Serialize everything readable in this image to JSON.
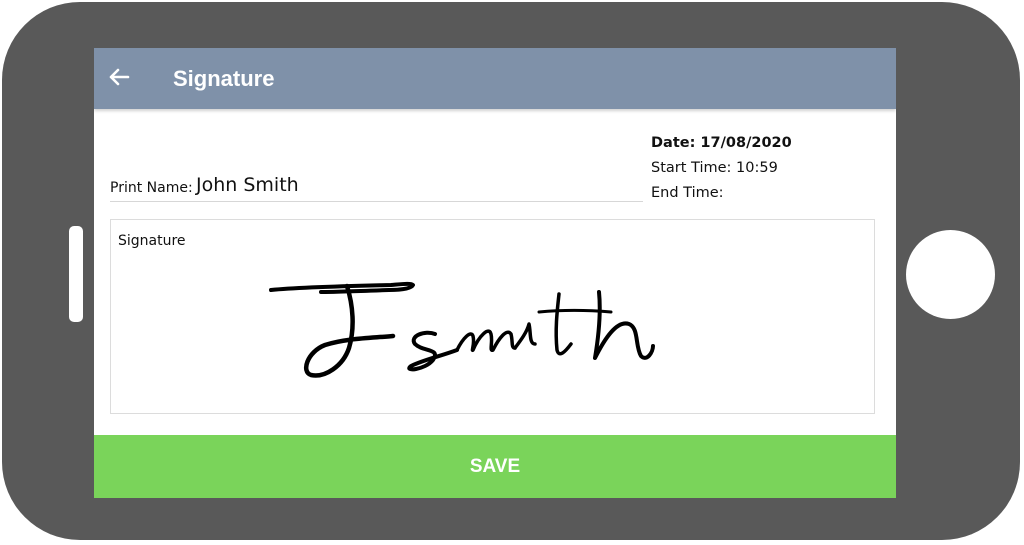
{
  "device": {
    "frame_color": "#595959"
  },
  "appbar": {
    "title": "Signature",
    "back_icon": "arrow-left-icon",
    "color": "#7f91a9"
  },
  "meta": {
    "date": "Date: 17/08/2020",
    "start_time": "Start Time: 10:59",
    "end_time": "End Time:"
  },
  "print_name": {
    "label": "Print Name:",
    "value": "John Smith"
  },
  "signature": {
    "label": "Signature",
    "drawing": "handwritten-signature"
  },
  "save": {
    "label": "SAVE",
    "color": "#7ad45a"
  }
}
